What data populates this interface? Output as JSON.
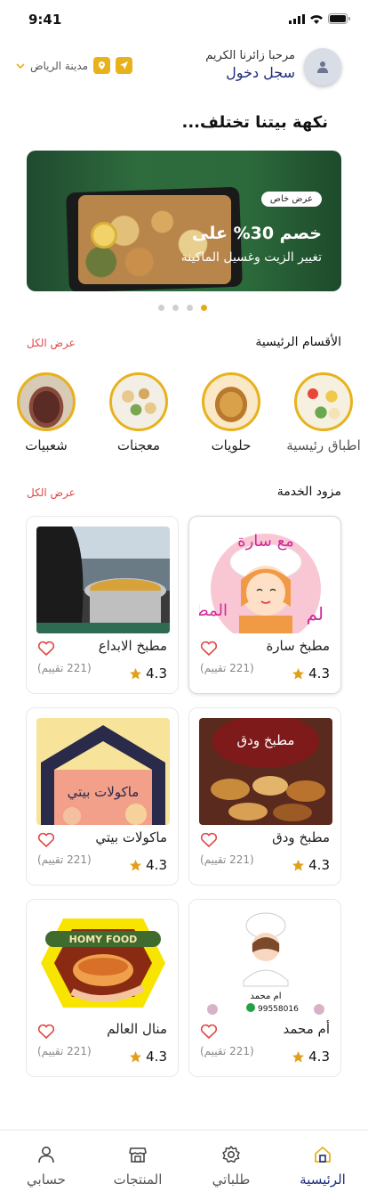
{
  "status": {
    "time": "9:41"
  },
  "header": {
    "welcome": "مرحبا زائرنا الكريم",
    "login": "سجل دخول",
    "city": "مدينة الرياض"
  },
  "tagline": "نكهة بيتنا تختلف...",
  "banner": {
    "badge": "عرض خاص",
    "title": "خصم 30% على",
    "subtitle": "تغيير الزيت وغسيل الماكينة",
    "slides_total": 4,
    "active_slide": 1
  },
  "categories": {
    "title": "الأقسام الرئيسية",
    "view_all": "عرض الكل",
    "items": [
      {
        "label": "اطباق رئيسية"
      },
      {
        "label": "حلويات"
      },
      {
        "label": "معجنات"
      },
      {
        "label": "شعبيات"
      }
    ]
  },
  "providers": {
    "title": "مزود الخدمة",
    "view_all": "عرض الكل",
    "items": [
      {
        "name": "مطبخ سارة",
        "rating": "4.3",
        "reviews": "(221 تقييم)"
      },
      {
        "name": "مطبخ الابداع",
        "rating": "4.3",
        "reviews": "(221 تقييم)"
      },
      {
        "name": "مطبخ ودق",
        "rating": "4.3",
        "reviews": "(221 تقييم)"
      },
      {
        "name": "ماكولات بيتي",
        "rating": "4.3",
        "reviews": "(221 تقييم)"
      },
      {
        "name": "أم محمد",
        "rating": "4.3",
        "reviews": "(221 تقييم)"
      },
      {
        "name": "منال العالم",
        "rating": "4.3",
        "reviews": "(221 تقييم)"
      }
    ],
    "image_text": {
      "sara_top": "مع سارة",
      "sara_side1": "لم",
      "sara_side2": "المط",
      "wadaq": "مطبخ ودق",
      "bayti": "ماكولات بيتي",
      "homy": "HOMY FOOD",
      "ummohamed": "ام محمد",
      "ummohamed_phone": "99558016"
    }
  },
  "nav": {
    "items": [
      {
        "label": "الرئيسية",
        "icon": "home-icon"
      },
      {
        "label": "طلباتي",
        "icon": "settings-icon"
      },
      {
        "label": "المنتجات",
        "icon": "store-icon"
      },
      {
        "label": "حسابي",
        "icon": "user-icon"
      }
    ],
    "active": 0
  },
  "colors": {
    "accent": "#e8b21c",
    "brand": "#1f2d7a",
    "link": "#e04848"
  }
}
